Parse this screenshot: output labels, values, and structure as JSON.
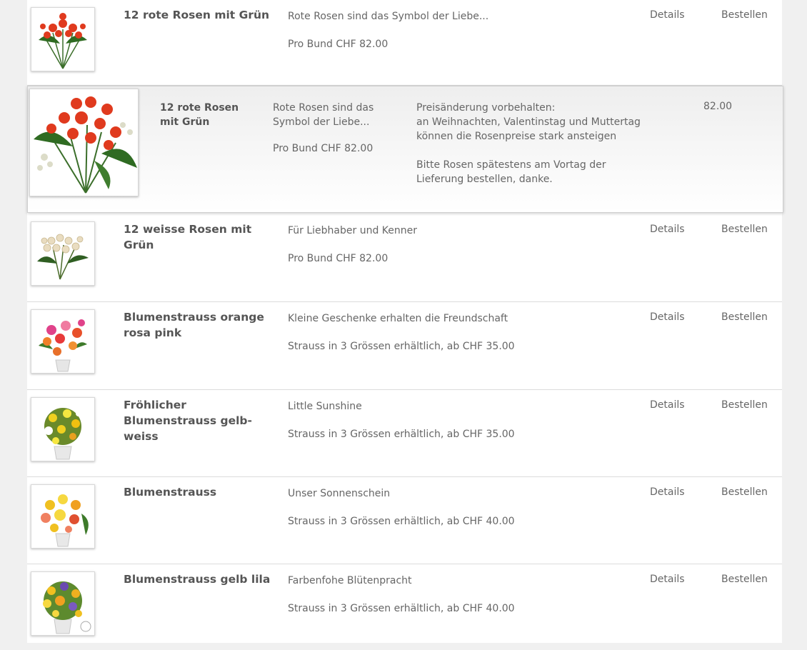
{
  "colors": {
    "panel_bg": "#ffffff",
    "page_bg": "#f0f0f0",
    "text": "#666666",
    "title": "#555555",
    "divider": "#dcdcdc"
  },
  "links": {
    "details": "Details",
    "order": "Bestellen"
  },
  "expanded": {
    "title": "12 rote Rosen mit Grün",
    "description": "Rote Rosen sind das Symbol der Liebe...",
    "price": "Pro Bund CHF 82.00",
    "note_lines": [
      "Preisänderung vorbehalten:",
      "an Weihnachten, Valentinstag und Muttertag",
      "können die Rosenpreise stark ansteigen",
      "",
      "Bitte Rosen spätestens am Vortag der",
      "Lieferung bestellen, danke."
    ],
    "amount": "82.00"
  },
  "products": [
    {
      "title": "12 rote Rosen mit Grün",
      "description": "Rote Rosen sind das Symbol der Liebe...",
      "price": "Pro Bund CHF 82.00",
      "image": "red-roses"
    },
    {
      "title": "12 weisse Rosen mit Grün",
      "description": "Für Liebhaber und Kenner",
      "price": "Pro Bund CHF 82.00",
      "image": "white-roses"
    },
    {
      "title": "Blumenstrauss orange rosa pink",
      "description": "Kleine Geschenke erhalten die Freundschaft",
      "price": "Strauss in 3 Grössen erhältlich, ab CHF 35.00",
      "image": "orange-pink-bouquet"
    },
    {
      "title": "Fröhlicher Blumenstrauss gelb-weiss",
      "description": "Little Sunshine",
      "price": "Strauss in 3 Grössen erhältlich, ab CHF 35.00",
      "image": "yellow-white-bouquet"
    },
    {
      "title": "Blumenstrauss",
      "description": "Unser Sonnenschein",
      "price": "Strauss in 3 Grössen erhältlich, ab CHF 40.00",
      "image": "sunshine-bouquet"
    },
    {
      "title": "Blumenstrauss gelb lila",
      "description": "Farbenfohe Blütenpracht",
      "price": "Strauss in 3 Grössen erhältlich, ab CHF 40.00",
      "image": "yellow-purple-bouquet"
    }
  ]
}
